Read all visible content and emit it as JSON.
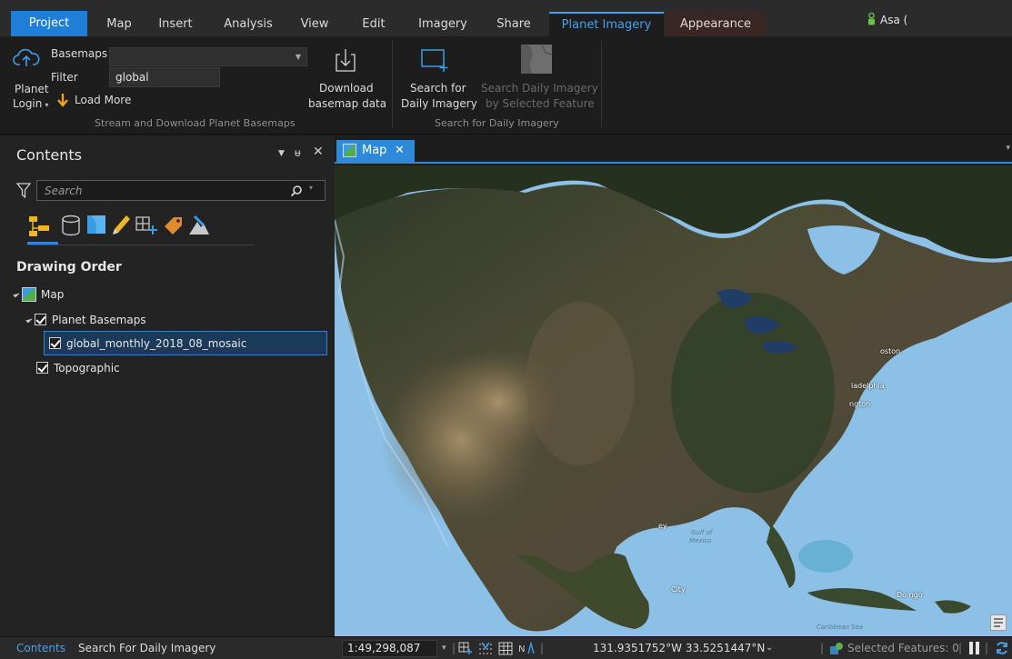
{
  "tabs": {
    "project": "Project",
    "map": "Map",
    "insert": "Insert",
    "analysis": "Analysis",
    "view": "View",
    "edit": "Edit",
    "imagery": "Imagery",
    "share": "Share",
    "planet_imagery": "Planet Imagery",
    "appearance": "Appearance"
  },
  "user": {
    "name": "Asa ("
  },
  "ribbon": {
    "planet_login_line1": "Planet",
    "planet_login_line2": "Login",
    "basemaps_label": "Basemaps",
    "basemaps_value": "",
    "filter_label": "Filter",
    "filter_value": "global",
    "load_more": "Load More",
    "download_line1": "Download",
    "download_line2": "basemap data",
    "group1_label": "Stream and Download Planet Basemaps",
    "search_line1": "Search for",
    "search_line2": "Daily Imagery",
    "search_selected_line1": "Search Daily Imagery",
    "search_selected_line2": "by Selected Feature",
    "group2_label": "Search for Daily Imagery"
  },
  "contents": {
    "title": "Contents",
    "search_placeholder": "Search",
    "drawing_order": "Drawing Order",
    "tree": {
      "map": "Map",
      "planet_basemaps": "Planet Basemaps",
      "mosaic": "global_monthly_2018_08_mosaic",
      "topographic": "Topographic"
    }
  },
  "map_view": {
    "tab_label": "Map",
    "labels": {
      "boston": "oston",
      "philadelphia": "ladelphia",
      "washington": "ngton",
      "gulf": "Gulf of",
      "mexico": "Mexico",
      "ey": "ey",
      "city": "City",
      "caribbean": "Caribbean Sea",
      "dom": "Do  ngo"
    }
  },
  "status": {
    "tab_contents": "Contents",
    "tab_search": "Search For Daily Imagery",
    "scale": "1:49,298,087",
    "coordinates": "131.9351752°W 33.5251447°N",
    "selected_features": "Selected Features: 0"
  },
  "colors": {
    "accent": "#2e8ad8",
    "project_tab": "#1f7fd8",
    "ocean": "#8fc2e8",
    "land": "#4a4a32"
  }
}
